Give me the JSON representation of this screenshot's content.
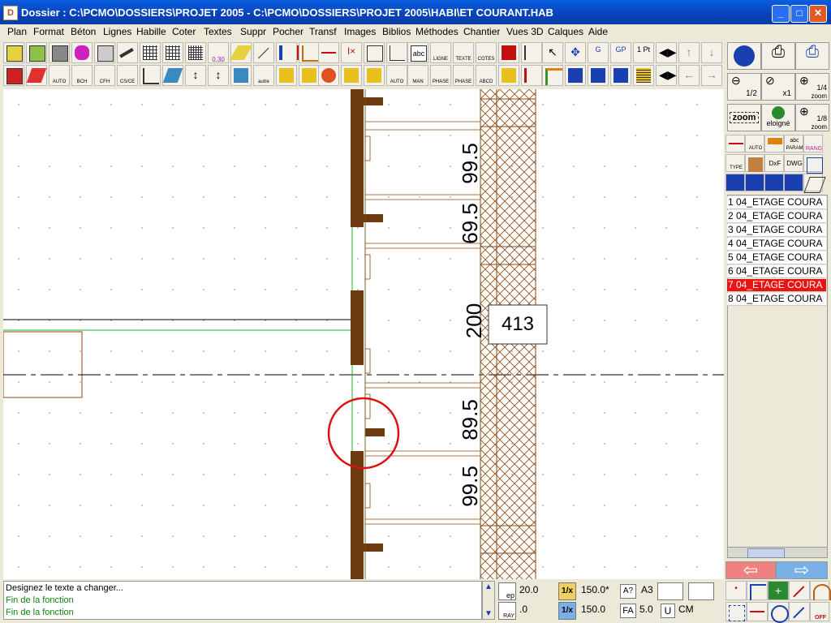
{
  "window": {
    "title": "Dossier : C:\\PCMO\\DOSSIERS\\PROJET 2005 - C:\\PCMO\\DOSSIERS\\PROJET 2005\\HABI\\ET COURANT.HAB",
    "minimize": "_",
    "maximize": "□",
    "close": "✕"
  },
  "menu": [
    "Plan",
    "Format",
    "Béton",
    "Lignes",
    "Habille",
    "Coter",
    "Textes",
    "Suppr",
    "Pocher",
    "Transf",
    "Images",
    "Biblios",
    "Méthodes",
    "Chantier",
    "Vues 3D",
    "Calques",
    "Aide"
  ],
  "toolbar_labels": {
    "t1": "0.30",
    "t2": "abc",
    "t3": "LIGNE",
    "t4": "TEXTE",
    "t5": "COTES",
    "t6": "1 Pt",
    "t7": "AUTO",
    "t8": "BCH",
    "t9": "CFH",
    "t10": "CS/CE",
    "t11": "autre",
    "t12": "AUTO",
    "t13": "MAN",
    "t14": "PHASE",
    "t15": "PHASE",
    "t16": "ABCD"
  },
  "drawing": {
    "dims": [
      "99.5",
      "69.5",
      "200",
      "89.5",
      "99.5"
    ],
    "box_value": "413"
  },
  "right_panel": {
    "zoom_half": "1/2",
    "zoom_x1": "x1",
    "zoom_quarter": "1/4",
    "zoom_label": "zoom",
    "zoom_btn": "zoom",
    "eloigne": "eloigné",
    "zoom_eighth": "1/8",
    "zoom_small": "zoom",
    "tools": [
      "AUTO",
      "abc",
      "PARAM",
      "RANG",
      "TYPE",
      "DxF",
      "DWG"
    ],
    "layers": [
      "1 04_ETAGE COURA",
      "2 04_ETAGE COURA",
      "3 04_ETAGE COURA",
      "4 04_ETAGE COURA",
      "5 04_ETAGE COURA",
      "6 04_ETAGE COURA",
      "7 04_ETAGE COURA",
      "8 04_ETAGE COURA"
    ],
    "selected_layer_index": 6
  },
  "status": {
    "lines": [
      "Designez le texte a changer...",
      "Fin de la fonction",
      "Fin de la fonction"
    ]
  },
  "params": {
    "ep_label": "ep",
    "ep_value": "20.0",
    "ray_label": "RAY",
    "ray_value": ".0",
    "scale1_label": "1/x",
    "scale1_value": "150.0*",
    "scale2_label": "1/x",
    "scale2_value": "150.0",
    "help_btn": "A?",
    "paper": "A3",
    "fa_label": "FA",
    "fa_value": "5.0",
    "u_label": "U",
    "cm_label": "CM",
    "off_label": "OFF"
  },
  "colors": {
    "accent": "#0a5fe0",
    "wall": "#6b3a10",
    "hatch": "#8b4a14",
    "selected_layer": "#e81414",
    "green_line": "#19b419",
    "circle": "#dd1111"
  }
}
